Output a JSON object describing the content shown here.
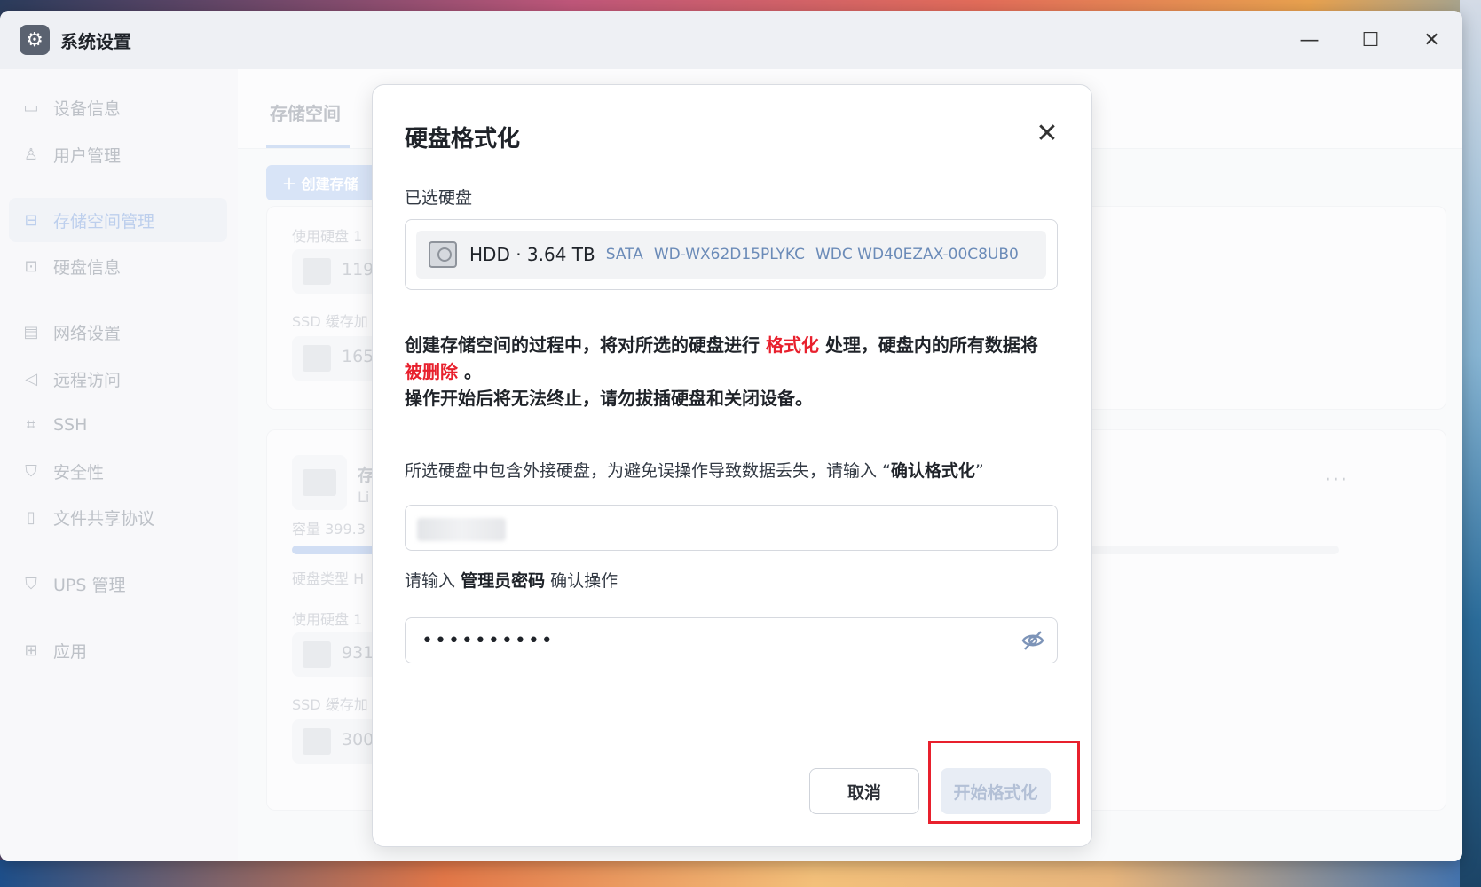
{
  "window": {
    "title": "系统设置",
    "controls": {
      "minimize": "—",
      "maximize": "☐",
      "close": "✕"
    }
  },
  "sidebar": {
    "items": [
      {
        "label": "设备信息",
        "icon": "monitor-icon"
      },
      {
        "label": "用户管理",
        "icon": "user-icon"
      },
      {
        "label": "存储空间管理",
        "icon": "storage-icon",
        "active": true
      },
      {
        "label": "硬盘信息",
        "icon": "disk-icon"
      },
      {
        "label": "网络设置",
        "icon": "network-icon"
      },
      {
        "label": "远程访问",
        "icon": "send-icon"
      },
      {
        "label": "SSH",
        "icon": "code-icon"
      },
      {
        "label": "安全性",
        "icon": "shield-check-icon"
      },
      {
        "label": "文件共享协议",
        "icon": "file-icon"
      },
      {
        "label": "UPS 管理",
        "icon": "shield-icon"
      },
      {
        "label": "应用",
        "icon": "apps-icon"
      }
    ]
  },
  "main": {
    "tab": "存储空间",
    "create_button": "＋ 创建存储",
    "card1": {
      "used_disk": "使用硬盘 1",
      "value1": "119",
      "ssd_cache": "SSD 缓存加",
      "value2": "165"
    },
    "card2": {
      "name_partial": "存",
      "sub_partial": "Li",
      "capacity": "容量  399.3",
      "disk_type": "硬盘类型  H",
      "used_disk": "使用硬盘 1",
      "value1": "931",
      "ssd_cache": "SSD 缓存加",
      "value2": "300",
      "more": "···"
    }
  },
  "dialog": {
    "title": "硬盘格式化",
    "close": "✕",
    "selected_label": "已选硬盘",
    "disk": {
      "main": "HDD · 3.64 TB",
      "interface": "SATA",
      "serial": "WD-WX62D15PLYKC",
      "model": "WDC WD40EZAX-00C8UB0"
    },
    "warning": {
      "part1": "创建存储空间的过程中，将对所选的硬盘进行",
      "format": "格式化",
      "part2": "处理，硬盘内的所有数据将",
      "deleted": "被删除",
      "part3": "。",
      "line2": "操作开始后将无法终止，请勿拔插硬盘和关闭设备。"
    },
    "confirm_prompt": {
      "text": "所选硬盘中包含外接硬盘，为避免误操作导致数据丢失，请输入 “",
      "keyword": "确认格式化",
      "end": "”"
    },
    "confirm_input_value": "",
    "password_prompt": {
      "pre": "请输入",
      "keyword": "管理员密码",
      "post": "确认操作"
    },
    "password_value": "••••••••••",
    "cancel_label": "取消",
    "start_label": "开始格式化"
  },
  "colors": {
    "danger": "#e8202d",
    "accent_light": "#9ab6e4"
  }
}
